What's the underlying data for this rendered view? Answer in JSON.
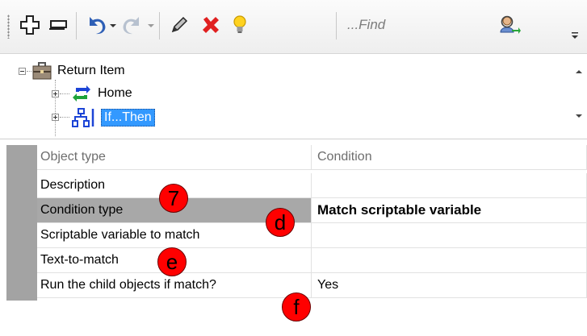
{
  "toolbar": {
    "find_placeholder": "...Find",
    "buttons": [
      {
        "icon": "add-node-icon"
      },
      {
        "icon": "collapse-icon"
      },
      {
        "icon": "undo-icon"
      },
      {
        "icon": "redo-icon"
      },
      {
        "icon": "pencil-icon"
      },
      {
        "icon": "delete-icon"
      },
      {
        "icon": "lightbulb-icon"
      },
      {
        "icon": "find-person-icon"
      }
    ]
  },
  "tree": {
    "nodes": [
      {
        "label": "Return Item",
        "icon": "briefcase-icon"
      },
      {
        "label": "Home",
        "icon": "loop-arrows-icon"
      },
      {
        "label": "If...Then",
        "icon": "branch-icon"
      }
    ]
  },
  "grid": {
    "header": {
      "name": "Object type",
      "value": "Condition"
    },
    "rows": [
      {
        "name": "Description",
        "value": ""
      },
      {
        "name": "Condition type",
        "value": "Match scriptable variable"
      },
      {
        "name": "Scriptable variable to match",
        "value": ""
      },
      {
        "name": "Text-to-match",
        "value": ""
      },
      {
        "name": "Run the child objects if match?",
        "value": "Yes"
      }
    ]
  },
  "markers": {
    "m7": "7",
    "md": "d",
    "me": "e",
    "mf": "f"
  },
  "colors": {
    "marker": "#ff0000",
    "selection": "#3399ff",
    "gutter": "#a3a3a3"
  }
}
